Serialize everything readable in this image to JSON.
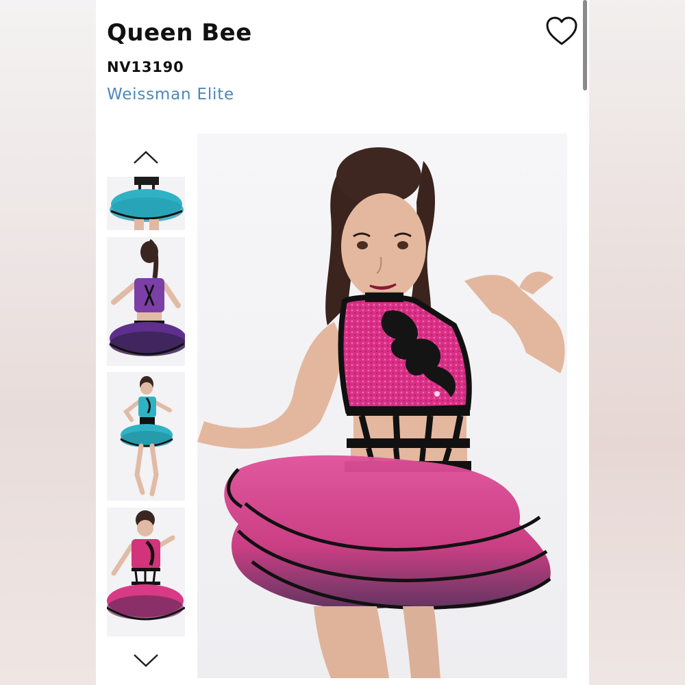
{
  "product": {
    "title": "Queen Bee",
    "sku": "NV13190",
    "brand": "Weissman Elite"
  },
  "icons": {
    "favorite": "heart-outline-icon",
    "thumbs_up": "chevron-up-icon",
    "thumbs_down": "chevron-down-icon"
  },
  "gallery": {
    "thumbnails": [
      {
        "variant": "turquoise tutu bottom (cropped)",
        "color": "#2aa8b8"
      },
      {
        "variant": "purple back view",
        "color": "#6b3a8f"
      },
      {
        "variant": "turquoise full body",
        "color": "#2aa8b8"
      },
      {
        "variant": "pink front view",
        "color": "#d2337a"
      }
    ],
    "main_variant": "pink front view"
  },
  "colors": {
    "brand_link": "#4d87b8",
    "text": "#111111",
    "costume_pink": "#d6337e",
    "trim_black": "#111111"
  }
}
